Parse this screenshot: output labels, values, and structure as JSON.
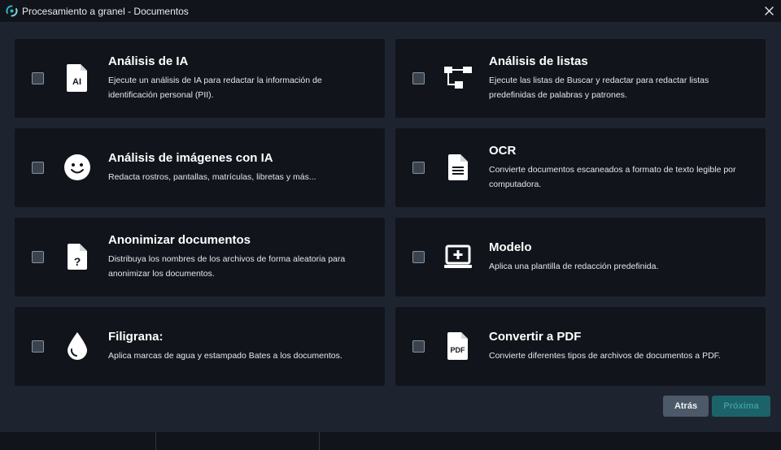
{
  "window": {
    "title": "Procesamiento a granel - Documentos",
    "logo_icon": "app-logo-icon",
    "close_icon": "close-icon"
  },
  "colors": {
    "background": "#1d2430",
    "card": "#11151b",
    "accent": "#1b6369",
    "secondary_button": "#4c5968"
  },
  "options": [
    {
      "id": "ai-analysis",
      "icon": "ai-document-icon",
      "title": "Análisis de IA",
      "description": "Ejecute un análisis de IA para redactar la información de identificación personal (PII).",
      "checked": false
    },
    {
      "id": "list-analysis",
      "icon": "workflow-icon",
      "title": "Análisis de listas",
      "description": "Ejecute las listas de Buscar y redactar para redactar listas predefinidas de palabras y patrones.",
      "checked": false
    },
    {
      "id": "image-ai-analysis",
      "icon": "smiley-face-icon",
      "title": "Análisis de imágenes con IA",
      "description": "Redacta rostros, pantallas, matrículas, libretas y más...",
      "checked": false
    },
    {
      "id": "ocr",
      "icon": "text-document-icon",
      "title": "OCR",
      "description": "Convierte documentos escaneados a formato de texto legible por computadora.",
      "checked": false
    },
    {
      "id": "anonymize",
      "icon": "question-document-icon",
      "title": "Anonimizar documentos",
      "description": "Distribuya los nombres de los archivos de forma aleatoria para anonimizar los documentos.",
      "checked": false
    },
    {
      "id": "template",
      "icon": "add-template-icon",
      "title": "Modelo",
      "description": "Aplica una plantilla de redacción predefinida.",
      "checked": false
    },
    {
      "id": "watermark",
      "icon": "water-drop-icon",
      "title": "Filigrana:",
      "description": "Aplica marcas de agua y estampado Bates a los documentos.",
      "checked": false
    },
    {
      "id": "convert-pdf",
      "icon": "pdf-document-icon",
      "title": "Convertir a PDF",
      "description": "Convierte diferentes tipos de archivos de documentos a PDF.",
      "checked": false
    }
  ],
  "buttons": {
    "back": "Atrás",
    "next": "Próxima",
    "next_enabled": false
  }
}
